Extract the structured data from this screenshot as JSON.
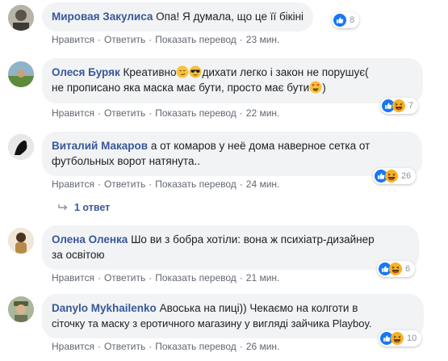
{
  "actions": {
    "like": "Нравится",
    "reply": "Ответить",
    "translate": "Показать перевод",
    "sep": "·"
  },
  "comments": [
    {
      "author": "Мировая Закулиса",
      "text": "Опа! Я думала, що це її бікіні",
      "time": "23 мин.",
      "reaction_count": "8",
      "reactions": [
        "like-icon"
      ]
    },
    {
      "author": "Олеся Буряк",
      "text_parts": [
        "Креативно",
        "дихати легко і закон не порушує(",
        "не прописано яка маска має бути, просто має бути",
        ")"
      ],
      "emojis": [
        "smirk-emoji",
        "sunglasses-emoji",
        "heart-eyes-emoji"
      ],
      "time": "22 мин.",
      "reaction_count": "7",
      "reactions": [
        "like-icon",
        "haha-icon"
      ]
    },
    {
      "author": "Виталий Макаров",
      "text_line1": "а от комаров у неё дома наверное сетка от",
      "text_line2": "футбольных ворот натянута..",
      "time": "24 мин.",
      "reaction_count": "26",
      "reactions": [
        "like-icon",
        "haha-icon"
      ],
      "replies_label": "1 ответ"
    },
    {
      "author": "Олена Оленка",
      "text_line1": "Шо ви з бобра хотіли: вона ж психіатр-дизайнер",
      "text_line2": "за освітою",
      "time": "21 мин.",
      "reaction_count": "6",
      "reactions": [
        "like-icon",
        "haha-icon"
      ]
    },
    {
      "author": "Danylo Mykhailenko",
      "text_line1": "Авоська на пиці)) Чекаємо на колготи в",
      "text_line2": "сіточку та маску з еротичного магазину у вигляді зайчика Playboy.",
      "time": "26 мин.",
      "reaction_count": "10",
      "reactions": [
        "like-icon",
        "haha-icon"
      ]
    }
  ],
  "colors": {
    "author": "#385898",
    "bubble": "#f2f3f5",
    "meta": "#616770",
    "like": "#1877f2",
    "haha": "#f7b125"
  }
}
